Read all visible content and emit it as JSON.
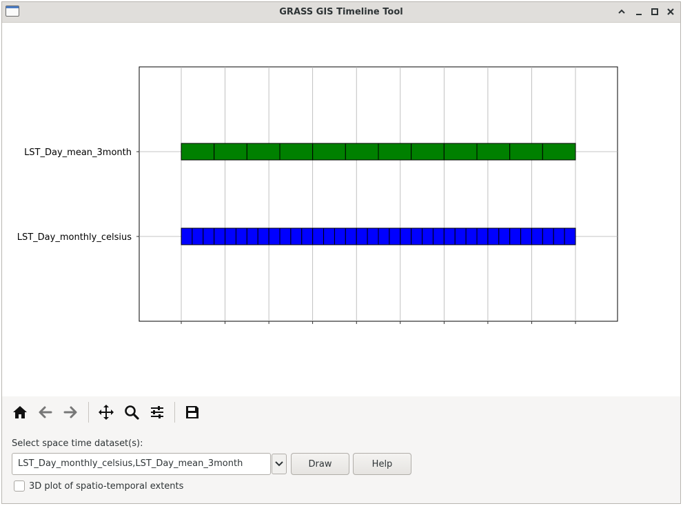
{
  "window": {
    "title": "GRASS GIS Timeline Tool"
  },
  "toolbar": {
    "items": [
      {
        "name": "home-icon",
        "tooltip": ""
      },
      {
        "name": "back-arrow-icon"
      },
      {
        "name": "forward-arrow-icon"
      },
      {
        "name": "pan-icon"
      },
      {
        "name": "zoom-icon"
      },
      {
        "name": "configure-subplots-icon"
      },
      {
        "name": "save-icon"
      }
    ]
  },
  "form": {
    "select_label": "Select space time dataset(s):",
    "dataset_value": "LST_Day_monthly_celsius,LST_Day_mean_3month",
    "draw_label": "Draw",
    "help_label": "Help",
    "plot3d_label": "3D plot of spatio-temporal extents",
    "plot3d_checked": false
  },
  "chart_data": {
    "type": "timeline",
    "grid": true,
    "xtick_count": 10,
    "series": [
      {
        "name": "LST_Day_mean_3month",
        "color": "#008000",
        "intervals": 12
      },
      {
        "name": "LST_Day_monthly_celsius",
        "color": "#0000ff",
        "intervals": 36
      }
    ]
  }
}
